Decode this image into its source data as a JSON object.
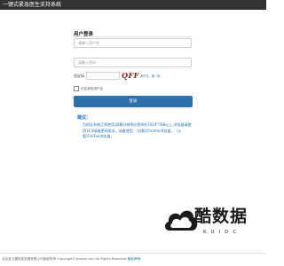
{
  "header": {
    "title": "一键式紧急医生支持系统"
  },
  "login": {
    "title": "用户登录",
    "username_placeholder": "请输入用户名",
    "password_placeholder": "请输入密码",
    "captcha_label": "验证码",
    "captcha_text": "QFF",
    "captcha_refresh": "看不清，换一张",
    "remember_label": "记住我的用户名",
    "submit_label": "登录"
  },
  "advice": {
    "title": "建议：",
    "text": "为保证系统正常使用,屏幕分辨率应保持在1024*768以上,浏览器请使用 IE 8或者更高版本，或者使用 （谷歌)Chrome浏览器。（火狐)FireFox浏览器。"
  },
  "watermark": {
    "text": "酷数据",
    "sub": "KUIDC"
  },
  "footer": {
    "copyright": "北京金卫捷科技发展有限公司版权所有 Copyright©xdcsoc.com All Rights Reserved",
    "link": "隐私声明"
  },
  "colors": {
    "accent": "#2f6fab",
    "header_bg": "#333333",
    "advice_text": "#1f6fb0"
  }
}
